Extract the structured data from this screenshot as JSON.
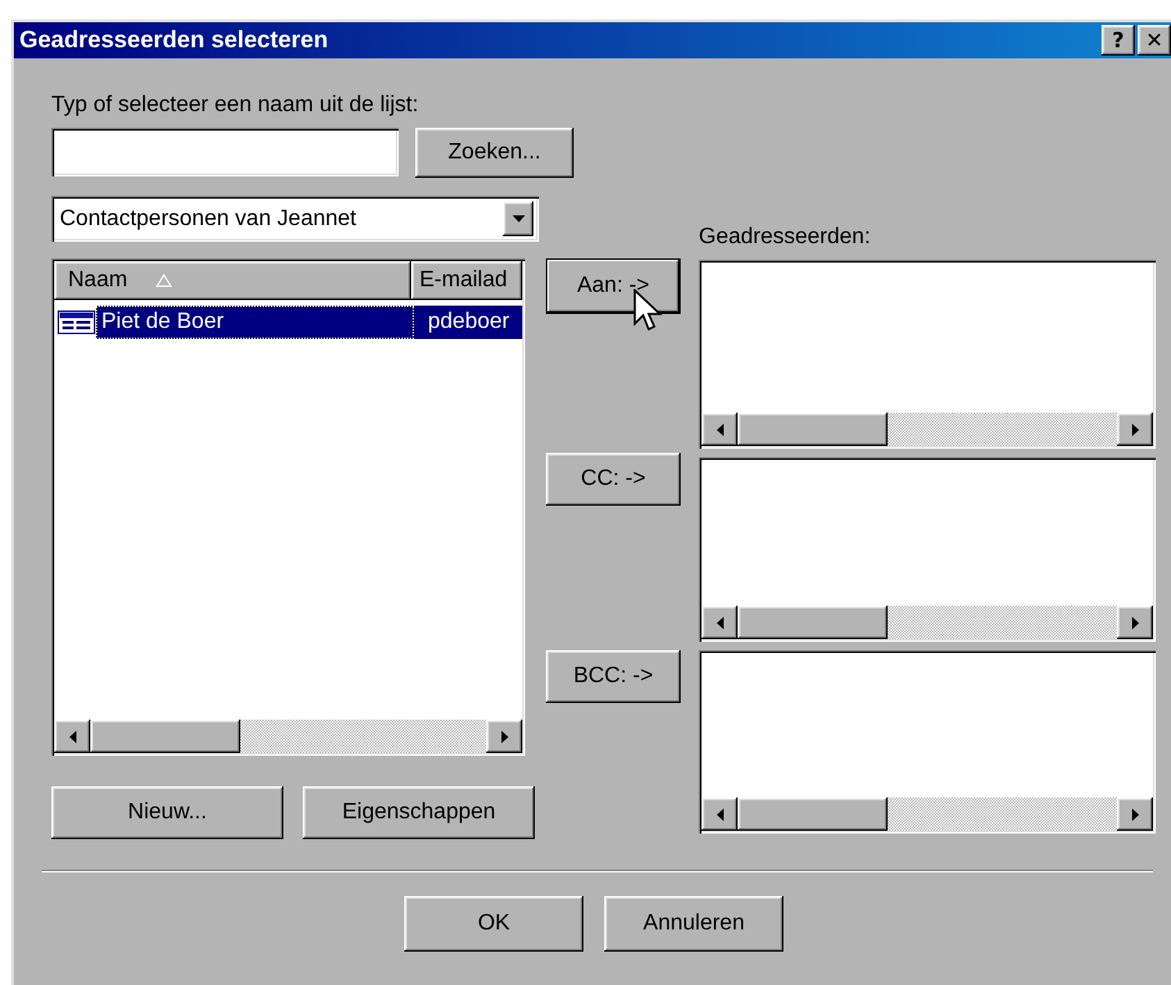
{
  "window": {
    "title": "Geadresseerden selecteren",
    "title_buttons": [
      "?",
      "✕"
    ]
  },
  "search": {
    "label": "Typ of selecteer een naam uit de lijst:",
    "button": "Zoeken..."
  },
  "address_book": {
    "value": "Contactpersonen van Jeannet"
  },
  "contacts": {
    "columns": [
      {
        "label": "Naam",
        "sorted": true
      },
      {
        "label": "E-mailad",
        "sorted": false
      }
    ],
    "rows": [
      {
        "name": "Piet de Boer",
        "email": "pdeboer",
        "selected": true
      }
    ]
  },
  "contact_buttons": [
    "Nieuw...",
    "Eigenschappen"
  ],
  "recipients": {
    "label": "Geadresseerden:",
    "fields": [
      {
        "button": "Aan: ->",
        "focused": true
      },
      {
        "button": "CC: ->",
        "focused": false
      },
      {
        "button": "BCC: ->",
        "focused": false
      }
    ]
  },
  "footer_buttons": [
    "OK",
    "Annuleren"
  ]
}
